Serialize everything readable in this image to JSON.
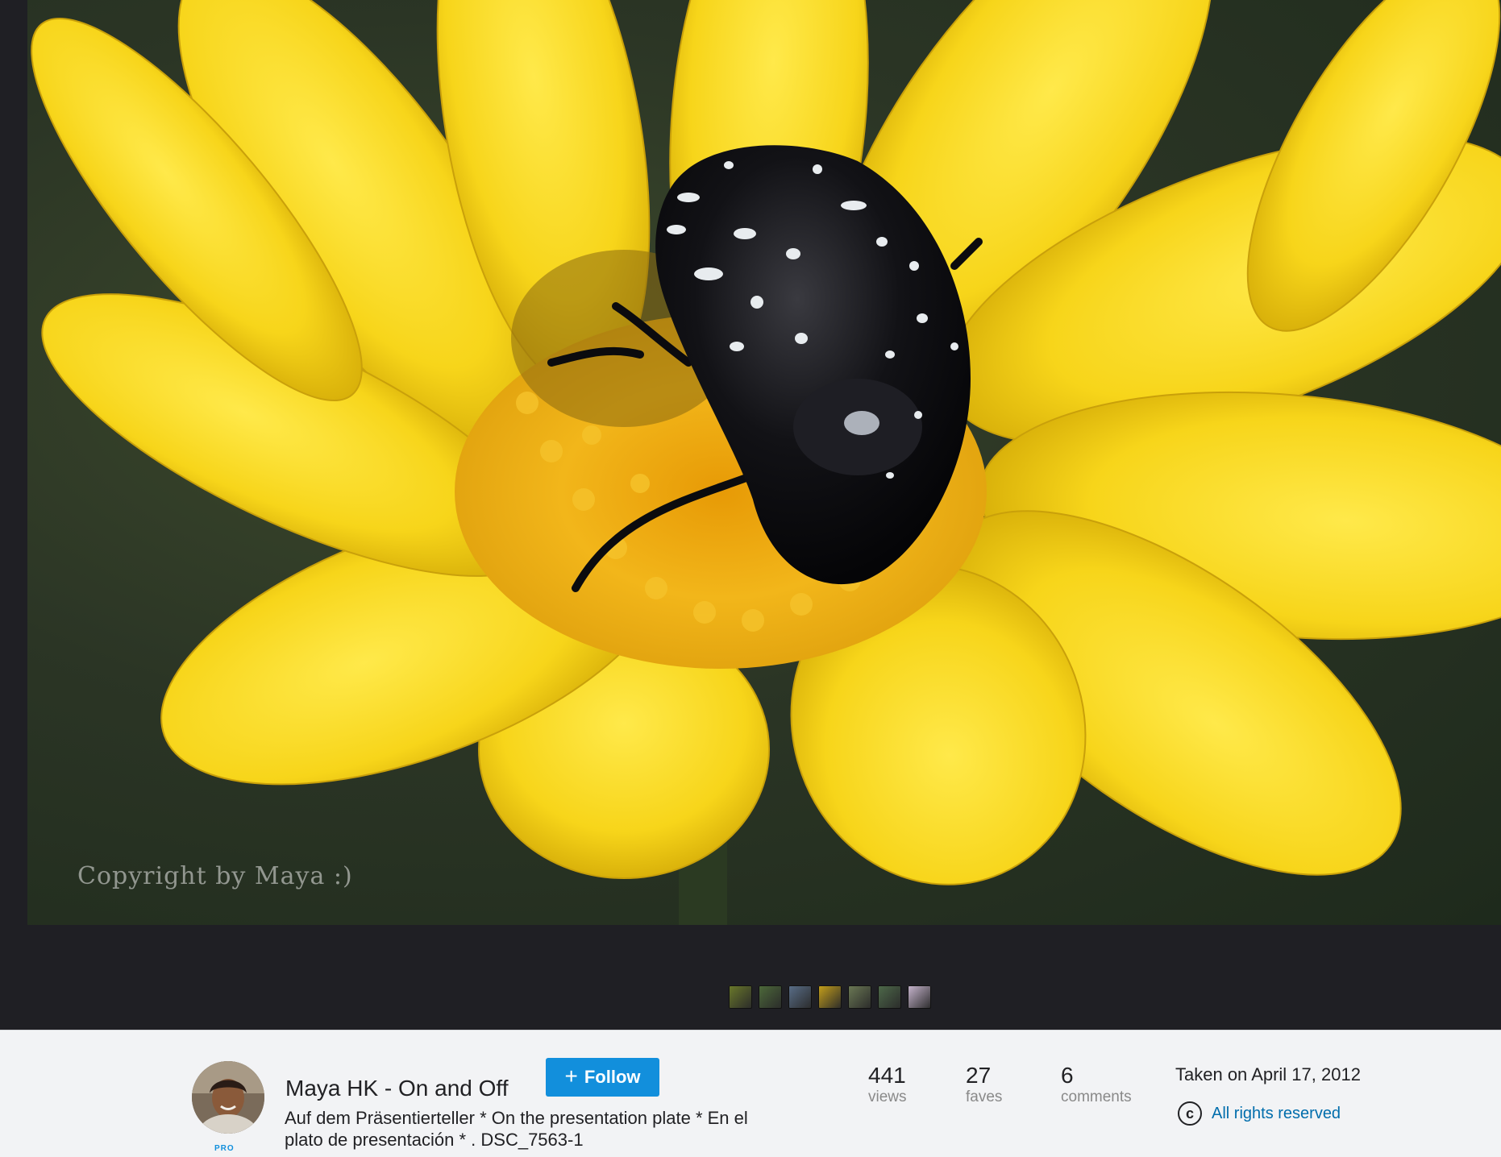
{
  "photo": {
    "watermark": "Copyright by Maya :)"
  },
  "filmstrip": {
    "thumbs": [
      "#6b7a2a",
      "#4d6a3a",
      "#5a6f8a",
      "#c8a21a",
      "#6c7a55",
      "#4e6a4a",
      "#c9b7d0"
    ]
  },
  "owner": {
    "name": "Maya HK - On and Off",
    "badge": "PRO",
    "follow_label": "Follow"
  },
  "photo_title": "Auf dem Präsentierteller * On the presentation plate * En el plato de presentación * . DSC_7563-1",
  "stats": {
    "views": {
      "value": "441",
      "label": "views"
    },
    "faves": {
      "value": "27",
      "label": "faves"
    },
    "comments": {
      "value": "6",
      "label": "comments"
    }
  },
  "taken": "Taken on April 17, 2012",
  "license": {
    "icon": "copyright-icon",
    "label": "All rights reserved"
  },
  "colors": {
    "accent": "#128fdc",
    "link": "#006dac",
    "stage_bg": "#1f1f24"
  }
}
